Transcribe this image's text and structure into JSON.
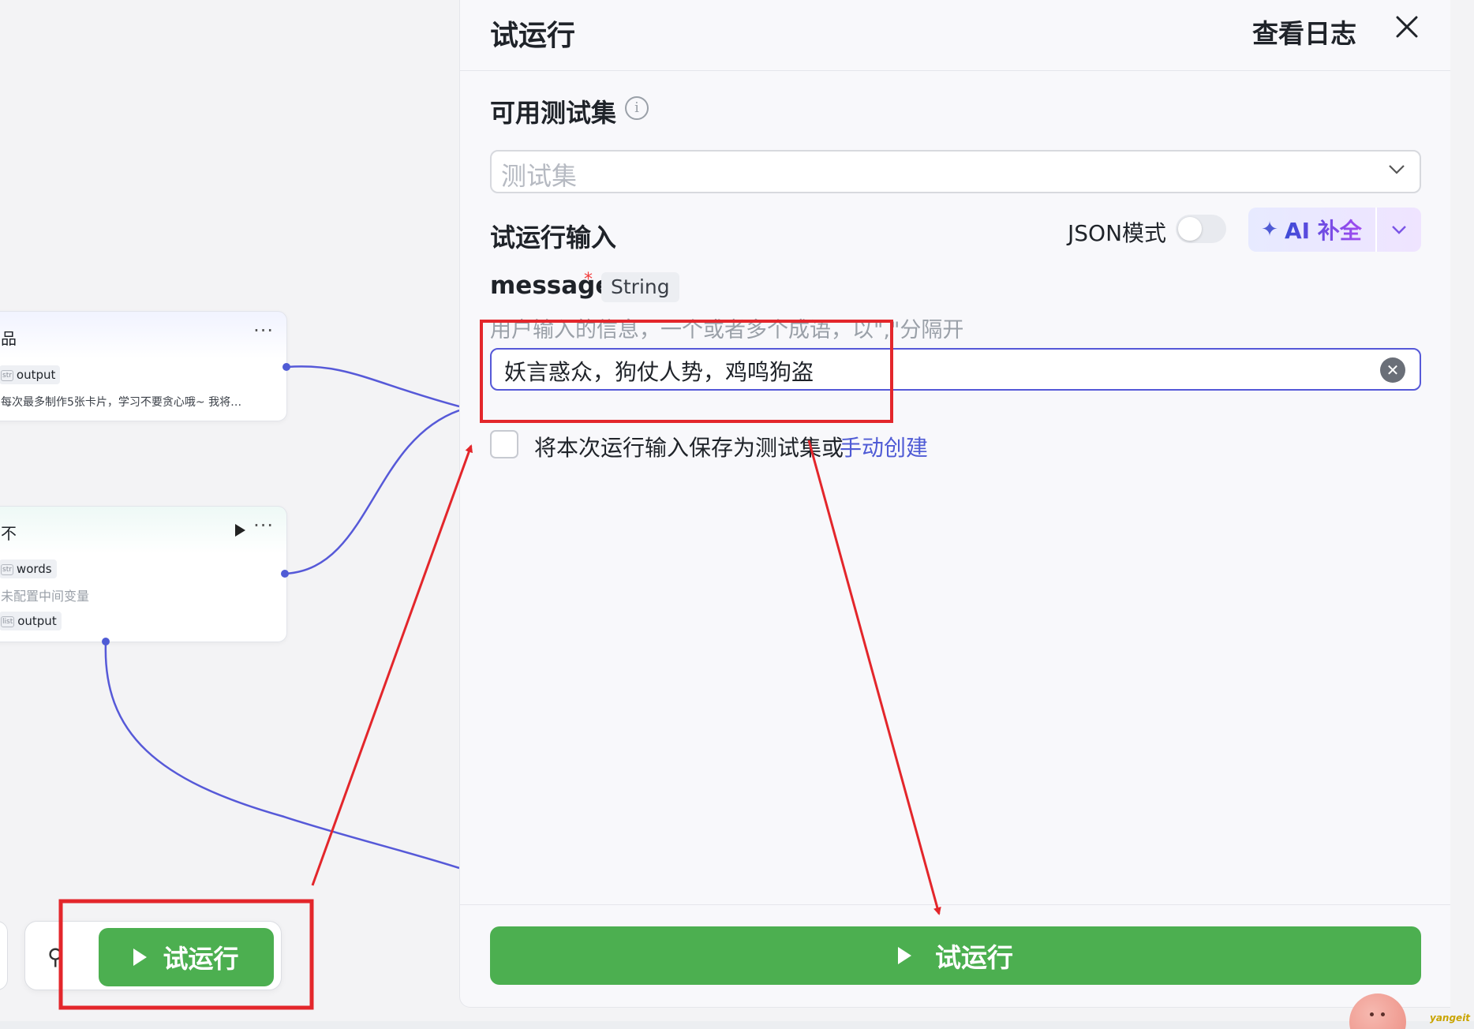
{
  "panel": {
    "title": "试运行",
    "view_log_label": "查看日志",
    "testset_heading": "可用测试集",
    "testset_placeholder": "测试集",
    "input_heading": "试运行输入",
    "json_mode_label": "JSON模式",
    "json_mode_on": false,
    "ai_fill_label": "AI 补全",
    "param": {
      "name": "message",
      "required_mark": "*",
      "type": "String",
      "description": "用户输入的信息，一个或者多个成语，以\",\"分隔开",
      "value": "妖言惑众，狗仗人势，鸡鸣狗盗"
    },
    "save_text": "将本次运行输入保存为测试集或",
    "manual_create_label": "手动创建",
    "run_button_label": "试运行"
  },
  "canvas": {
    "node1": {
      "title": "品",
      "output_tag": "output",
      "output_type": "str",
      "description": "每次最多制作5张卡片，学习不要贪心哦~ 我将…"
    },
    "node2": {
      "title": "不",
      "words_tag": "words",
      "words_type": "str",
      "unconfigured": "未配置中间变量",
      "output_tag": "output",
      "output_type": "list"
    },
    "toolbar_run_label": "试运行"
  },
  "watermark": "yangeit",
  "colors": {
    "accent": "#4f5bd5",
    "run_green": "#4caf50",
    "annotation_red": "#e3262b"
  }
}
